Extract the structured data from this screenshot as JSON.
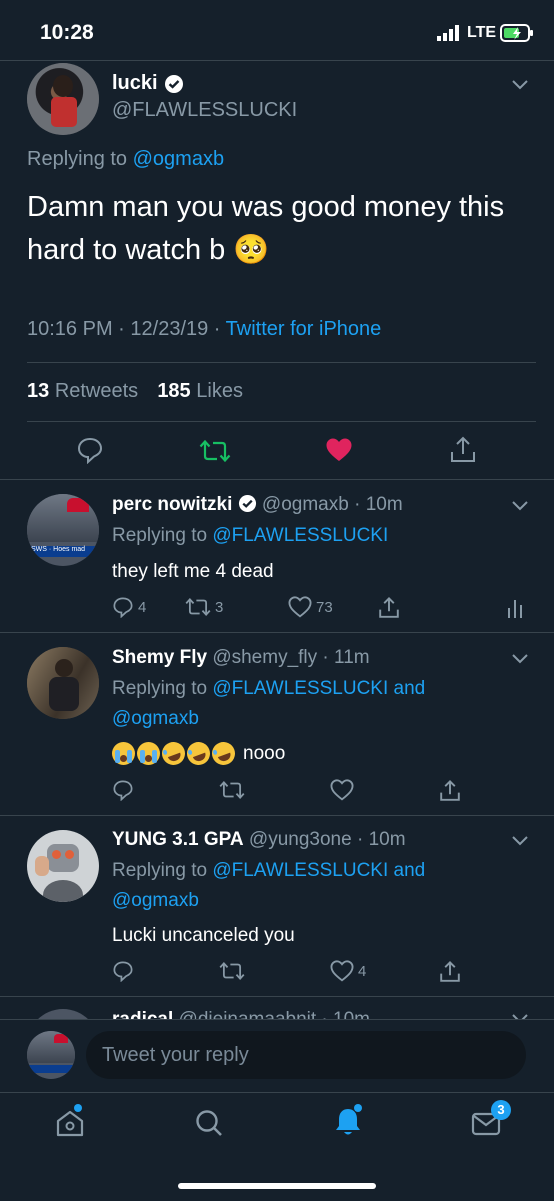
{
  "status_bar": {
    "time": "10:28",
    "network": "LTE"
  },
  "main_tweet": {
    "display_name": "lucki",
    "handle": "@FLAWLESSLUCKI",
    "replying_prefix": "Replying to",
    "replying_to": "@ogmaxb",
    "text": "Damn man you was good money this hard to watch b 🥺",
    "time": "10:16 PM",
    "date": "12/23/19",
    "source": "Twitter for iPhone",
    "retweets_count": "13",
    "retweets_label": "Retweets",
    "likes_count": "185",
    "likes_label": "Likes"
  },
  "replies": [
    {
      "display_name": "perc nowitzki",
      "handle": "@ogmaxb",
      "time": "10m",
      "replying_prefix": "Replying to",
      "replying_to": "@FLAWLESSLUCKI",
      "replying_to_extra": "",
      "text": "they left me 4 dead",
      "reply_count": "4",
      "retweet_count": "3",
      "like_count": "73"
    },
    {
      "display_name": "Shemy Fly",
      "handle": "@shemy_fly",
      "time": "11m",
      "replying_prefix": "Replying to",
      "replying_to": "@FLAWLESSLUCKI and",
      "replying_to_extra": "@ogmaxb",
      "text": "nooo",
      "reply_count": "",
      "retweet_count": "",
      "like_count": ""
    },
    {
      "display_name": "YUNG 3.1 GPA",
      "handle": "@yung3one",
      "time": "10m",
      "replying_prefix": "Replying to",
      "replying_to": "@FLAWLESSLUCKI and",
      "replying_to_extra": "@ogmaxb",
      "text": "Lucki uncanceled you",
      "reply_count": "",
      "retweet_count": "",
      "like_count": "4"
    }
  ],
  "partial_reply": {
    "display_name": "radical",
    "handle": "@dieinamaabnit",
    "time": "10m"
  },
  "composer": {
    "placeholder": "Tweet your reply"
  },
  "tab_bar": {
    "messages_badge": "3"
  },
  "colors": {
    "background": "#15202b",
    "accent": "#1da1f2",
    "like": "#e0245e",
    "retweet": "#17bf63",
    "muted": "#8899a6"
  }
}
